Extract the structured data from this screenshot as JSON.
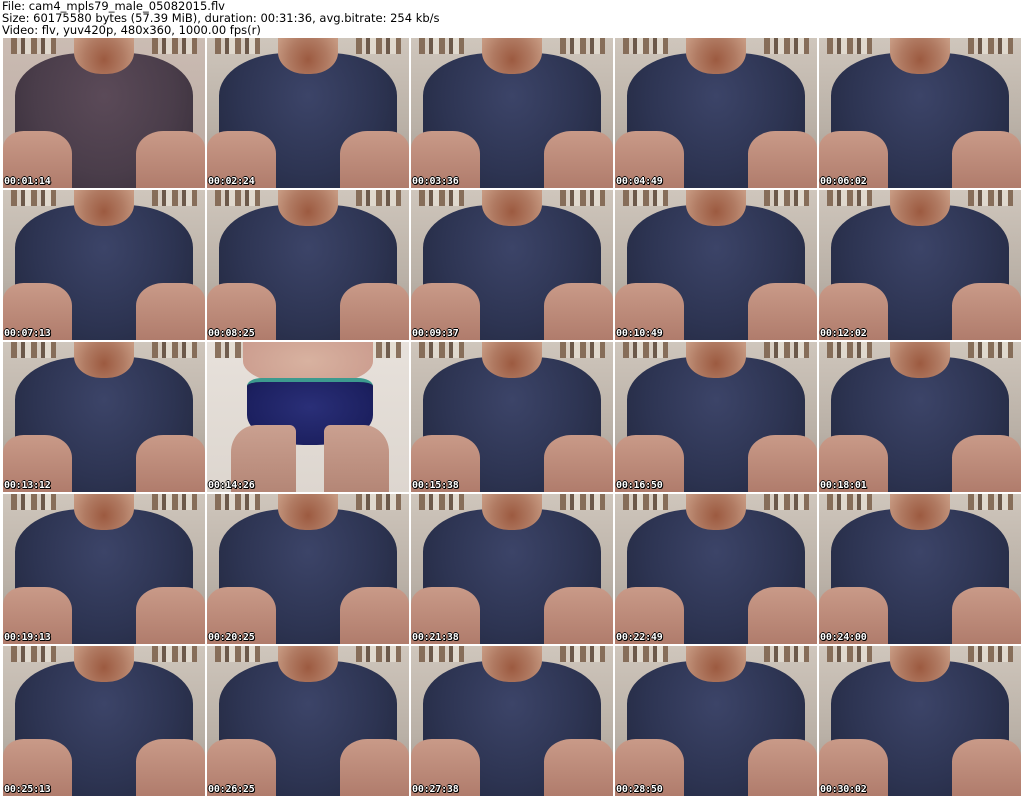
{
  "header": {
    "file_line": "File: cam4_mpls79_male_05082015.flv",
    "size_line": "Size: 60175580 bytes (57.39 MiB), duration: 00:31:36, avg.bitrate: 254 kb/s",
    "video_line": "Video: flv, yuv420p, 480x360, 1000.00 fps(r)"
  },
  "thumbnails": [
    {
      "time": "00:01:14",
      "variant": "tint-purple"
    },
    {
      "time": "00:02:24",
      "variant": ""
    },
    {
      "time": "00:03:36",
      "variant": ""
    },
    {
      "time": "00:04:49",
      "variant": ""
    },
    {
      "time": "00:06:02",
      "variant": ""
    },
    {
      "time": "00:07:13",
      "variant": ""
    },
    {
      "time": "00:08:25",
      "variant": ""
    },
    {
      "time": "00:09:37",
      "variant": ""
    },
    {
      "time": "00:10:49",
      "variant": ""
    },
    {
      "time": "00:12:02",
      "variant": ""
    },
    {
      "time": "00:13:12",
      "variant": ""
    },
    {
      "time": "00:14:26",
      "variant": "briefs"
    },
    {
      "time": "00:15:38",
      "variant": ""
    },
    {
      "time": "00:16:50",
      "variant": ""
    },
    {
      "time": "00:18:01",
      "variant": ""
    },
    {
      "time": "00:19:13",
      "variant": ""
    },
    {
      "time": "00:20:25",
      "variant": ""
    },
    {
      "time": "00:21:38",
      "variant": ""
    },
    {
      "time": "00:22:49",
      "variant": ""
    },
    {
      "time": "00:24:00",
      "variant": ""
    },
    {
      "time": "00:25:13",
      "variant": ""
    },
    {
      "time": "00:26:25",
      "variant": ""
    },
    {
      "time": "00:27:38",
      "variant": ""
    },
    {
      "time": "00:28:50",
      "variant": ""
    },
    {
      "time": "00:30:02",
      "variant": ""
    }
  ]
}
